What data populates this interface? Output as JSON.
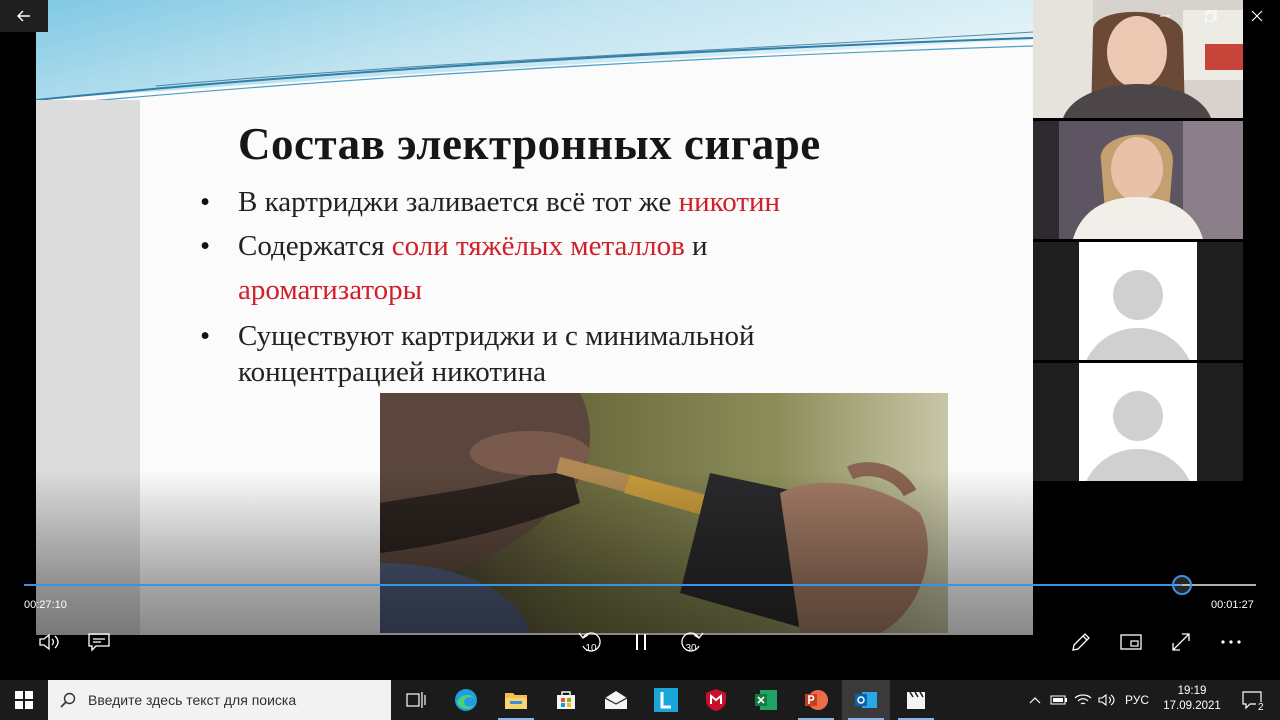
{
  "slide": {
    "title": "Состав электронных сигаре",
    "bullets": [
      {
        "pre": "В картриджи заливается всё тот же ",
        "red": "никотин",
        "post": ""
      },
      {
        "pre": "Содержатся ",
        "red": "соли тяжёлых металлов",
        "post": " и",
        "red2": "ароматизаторы"
      },
      {
        "line1": "Существуют картриджи и с минимальной",
        "line2": "концентрацией никотина"
      }
    ]
  },
  "player": {
    "elapsed": "00:27:10",
    "remaining": "00:01:27",
    "progress": 0.94,
    "skip_back_label": "10",
    "skip_forward_label": "30"
  },
  "taskbar": {
    "search_placeholder": "Введите здесь текст для поиска",
    "language": "РУС",
    "time": "19:19",
    "date": "17.09.2021",
    "notification_count": "2",
    "apps": [
      "task-view",
      "edge",
      "file-explorer",
      "store",
      "mail",
      "l-app",
      "mcafee",
      "excel",
      "powerpoint",
      "outlook",
      "video-editor"
    ]
  },
  "colors": {
    "accent": "#3a92e0",
    "highlight_text": "#d0202a",
    "taskbar": "#1b1b1b"
  }
}
